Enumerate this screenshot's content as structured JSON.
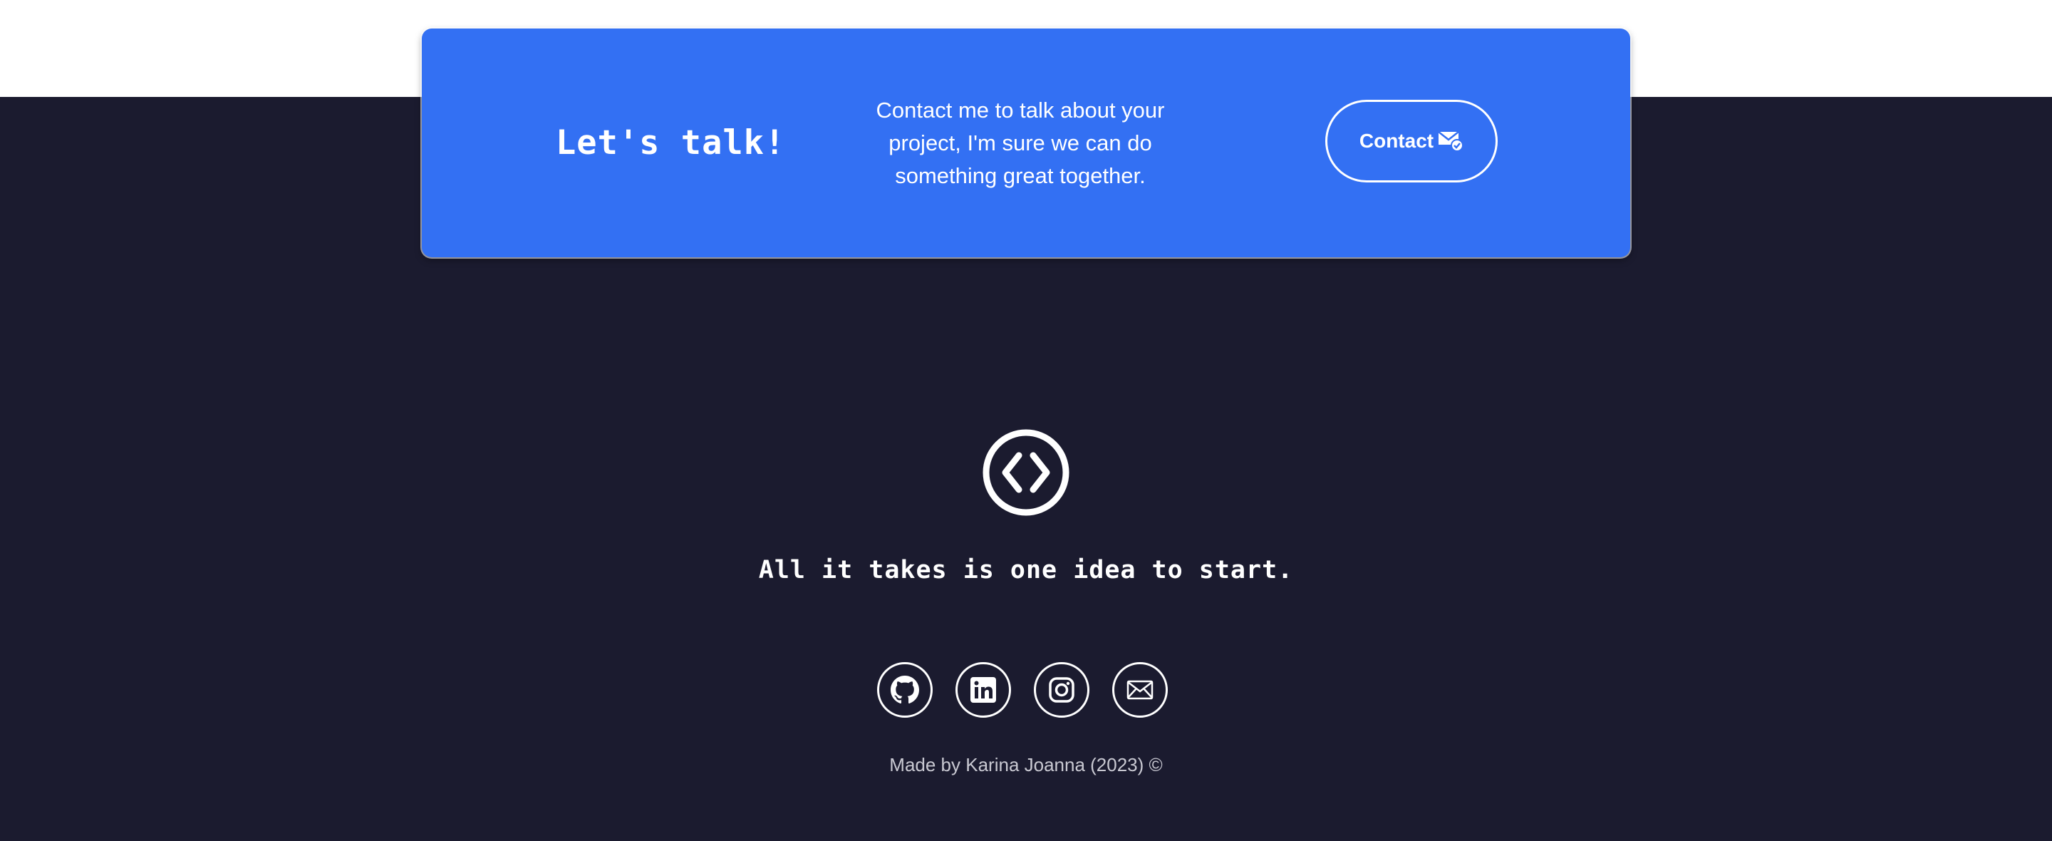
{
  "cta": {
    "title": "Let's talk!",
    "text": "Contact me to talk about your project, I'm sure we can do something great together.",
    "button_label": "Contact",
    "button_icon": "mail-check-icon"
  },
  "footer": {
    "logo_icon": "code-brackets-icon",
    "tagline": "All it takes is one idea to start.",
    "socials": [
      {
        "icon": "github-icon"
      },
      {
        "icon": "linkedin-icon"
      },
      {
        "icon": "instagram-icon"
      },
      {
        "icon": "email-icon"
      }
    ],
    "copyright": "Made by Karina Joanna (2023) ©"
  },
  "colors": {
    "accent": "#3370f3",
    "footer_background": "#1b1b2f",
    "text": "#ffffff"
  }
}
